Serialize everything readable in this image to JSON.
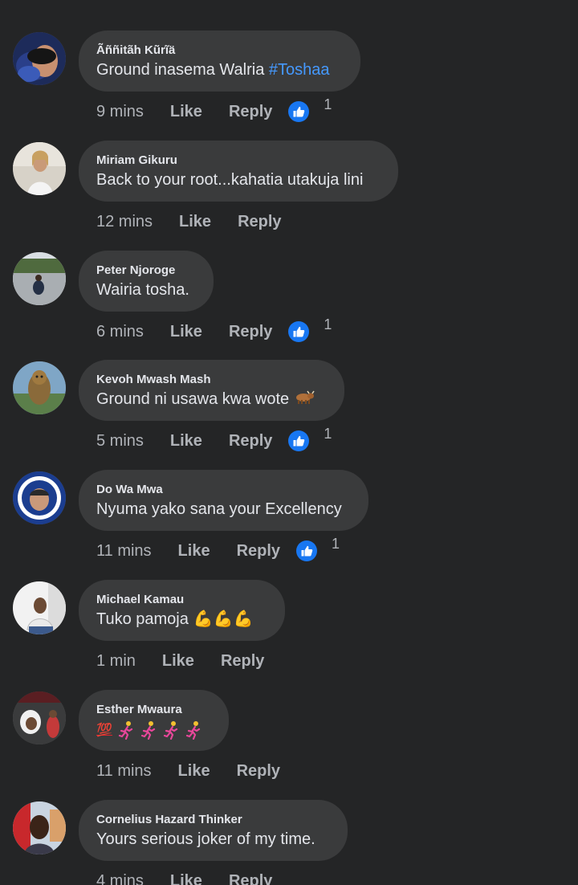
{
  "labels": {
    "like": "Like",
    "reply": "Reply"
  },
  "comments": [
    {
      "author": "Ãññitãh Kũrĩä",
      "text": "Ground inasema Walria ",
      "hashtag": "#Toshaa",
      "time": "9 mins",
      "reactions": "1"
    },
    {
      "author": "Miriam Gikuru",
      "text": "Back to your root...kahatia utakuja lini",
      "time": "12 mins"
    },
    {
      "author": "Peter Njoroge",
      "text": "Wairia tosha.",
      "time": "6 mins",
      "reactions": "1"
    },
    {
      "author": "Kevoh Mwash Mash",
      "text": "Ground ni usawa kwa wote",
      "time": "5 mins",
      "reactions": "1",
      "emoji": "ox"
    },
    {
      "author": "Do Wa Mwa",
      "text": "Nyuma yako sana your Excellency",
      "time": "11 mins",
      "reactions": "1"
    },
    {
      "author": "Michael Kamau",
      "text": "Tuko pamoja",
      "time": "1 min",
      "emoji": "💪💪💪"
    },
    {
      "author": "Esther Mwaura",
      "text": "",
      "time": "11 mins",
      "emoji": "💯"
    },
    {
      "author": "Cornelius Hazard Thinker",
      "text": "Yours serious joker of my time.",
      "time": "4 mins"
    }
  ],
  "colors": {
    "background": "#242526",
    "bubble": "#3a3b3c",
    "text": "#e4e6eb",
    "muted": "#b0b3b8",
    "link": "#4599ff",
    "like_blue": "#1877f2"
  },
  "icons": {
    "reaction": "like-thumbs-up-icon"
  }
}
